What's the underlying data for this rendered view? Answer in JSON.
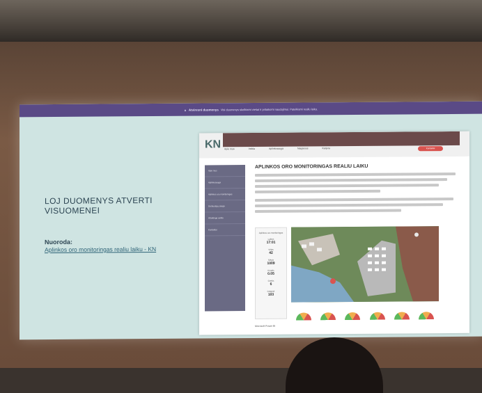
{
  "banner": {
    "bold": "Atviresni duomenys",
    "text": "Visi duomenys skelbiami viešai ir pritaikomi naudojimui. Pateikiami realiu laiku."
  },
  "slide": {
    "title": "LOJ DUOMENYS ATVERTI VISUOMENEI",
    "reference_label": "Nuoroda:",
    "reference_link": "Aplinkos oro monitoringas realiu laiku - KN"
  },
  "embedded_site": {
    "page_title": "APLINKOS ORO MONITORINGAS REALIU LAIKU",
    "nav_items": [
      "Apie mus",
      "Veikla",
      "Aplinkosauga",
      "Naujienos",
      "Karjera"
    ],
    "contact_button": "Kontaktai",
    "side_menu": [
      "Apie mus",
      "Aplinkosauga",
      "Aplinkos oro monitoringas",
      "Darbuotojų sauga",
      "Atsakinga veikla",
      "Kontaktai"
    ],
    "stats_header": "Aplinkos oro monitoringas",
    "stats": [
      {
        "label": "Laikas",
        "value": "17:01"
      },
      {
        "label": "Vėjas",
        "value": "42"
      },
      {
        "label": "Slėgis",
        "value": "1009"
      },
      {
        "label": "Kryptis",
        "value": "0.05"
      },
      {
        "label": "Greitis",
        "value": "6"
      },
      {
        "label": "Drėgmė",
        "value": "103"
      }
    ],
    "powered_by": "Microsoft Power BI"
  }
}
